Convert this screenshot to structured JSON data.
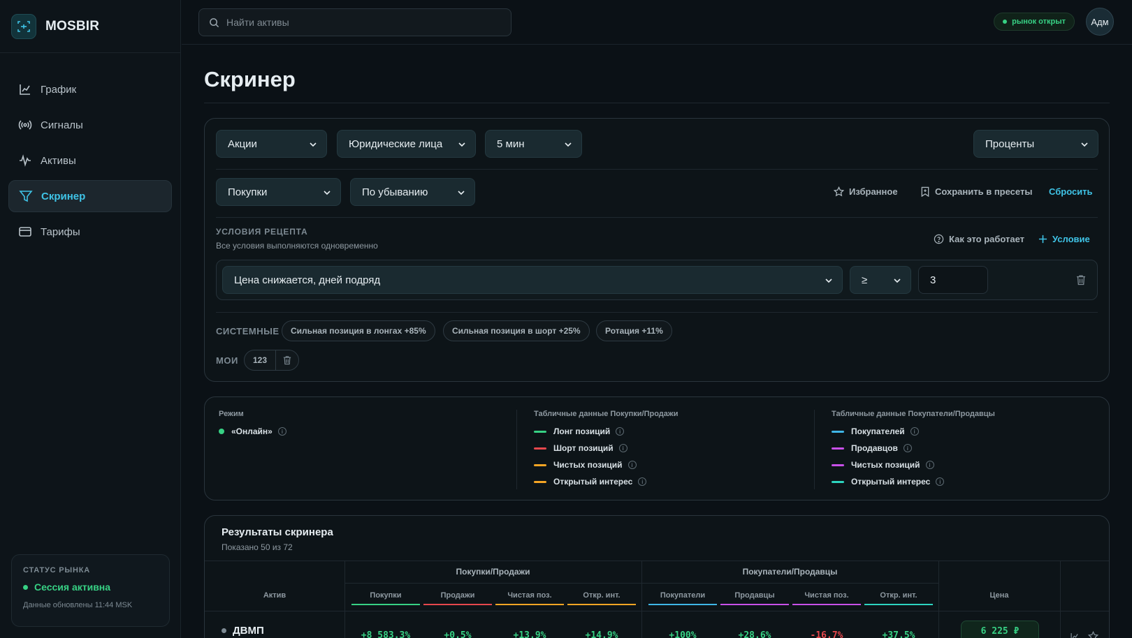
{
  "app": {
    "name": "MOSBIR"
  },
  "sidebar": {
    "items": [
      {
        "label": "График",
        "icon": "chart-line-icon"
      },
      {
        "label": "Сигналы",
        "icon": "broadcast-icon"
      },
      {
        "label": "Активы",
        "icon": "activity-icon"
      },
      {
        "label": "Скринер",
        "icon": "filter-icon",
        "active": true
      },
      {
        "label": "Тарифы",
        "icon": "card-icon"
      }
    ],
    "status": {
      "title": "СТАТУС РЫНКА",
      "session": "Сессия активна",
      "updated": "Данные обновлены 11:44 MSK"
    }
  },
  "topbar": {
    "search_placeholder": "Найти активы",
    "market_status": "рынок открыт",
    "avatar_text": "Адм"
  },
  "page": {
    "title": "Скринер"
  },
  "filters": {
    "asset_type": "Акции",
    "participant": "Юридические лица",
    "interval": "5 мин",
    "units": "Проценты",
    "sort_by": "Покупки",
    "order": "По убыванию",
    "favorites_label": "Избранное",
    "save_preset_label": "Сохранить в пресеты",
    "reset_label": "Сбросить",
    "conditions_title": "УСЛОВИЯ РЕЦЕПТА",
    "conditions_sub": "Все условия выполняются одновременно",
    "how_it_works": "Как это работает",
    "add_condition": "Условие",
    "condition": {
      "field": "Цена снижается, дней подряд",
      "operator": "≥",
      "value": "3"
    },
    "system_label": "СИСТЕМНЫЕ",
    "system_presets": [
      "Сильная позиция в лонгах +85%",
      "Сильная позиция в шорт +25%",
      "Ротация +11%"
    ],
    "my_label": "МОИ",
    "my_presets": [
      "123"
    ]
  },
  "legend": {
    "mode_title": "Режим",
    "mode_value": "«Онлайн»",
    "col2_title": "Табличные данные Покупки/Продажи",
    "col2_items": [
      {
        "label": "Лонг позиций",
        "color": "#37d184"
      },
      {
        "label": "Шорт позиций",
        "color": "#e5484d"
      },
      {
        "label": "Чистых позиций",
        "color": "#f5a524"
      },
      {
        "label": "Открытый интерес",
        "color": "#f5a524"
      }
    ],
    "col3_title": "Табличные данные Покупатели/Продавцы",
    "col3_items": [
      {
        "label": "Покупателей",
        "color": "#3fb6e6"
      },
      {
        "label": "Продавцов",
        "color": "#c850e8"
      },
      {
        "label": "Чистых позиций",
        "color": "#c850e8"
      },
      {
        "label": "Открытый интерес",
        "color": "#2dd4bf"
      }
    ]
  },
  "results": {
    "title": "Результаты скринера",
    "shown": "Показано 50 из 72",
    "group1": "Покупки/Продажи",
    "group2": "Покупатели/Продавцы",
    "col_asset": "Актив",
    "col_price": "Цена",
    "cols1": [
      "Покупки",
      "Продажи",
      "Чистая поз.",
      "Откр. инт."
    ],
    "cols2": [
      "Покупатели",
      "Продавцы",
      "Чистая поз.",
      "Откр. инт."
    ],
    "rows": [
      {
        "asset": "ДВМП",
        "values1": [
          "+8 583.3%",
          "+0.5%",
          "+13.9%",
          "+14.9%"
        ],
        "values2": [
          "+100%",
          "+28.6%",
          "-16.7%",
          "+37.5%"
        ],
        "price": "6 225 ₽"
      }
    ]
  }
}
